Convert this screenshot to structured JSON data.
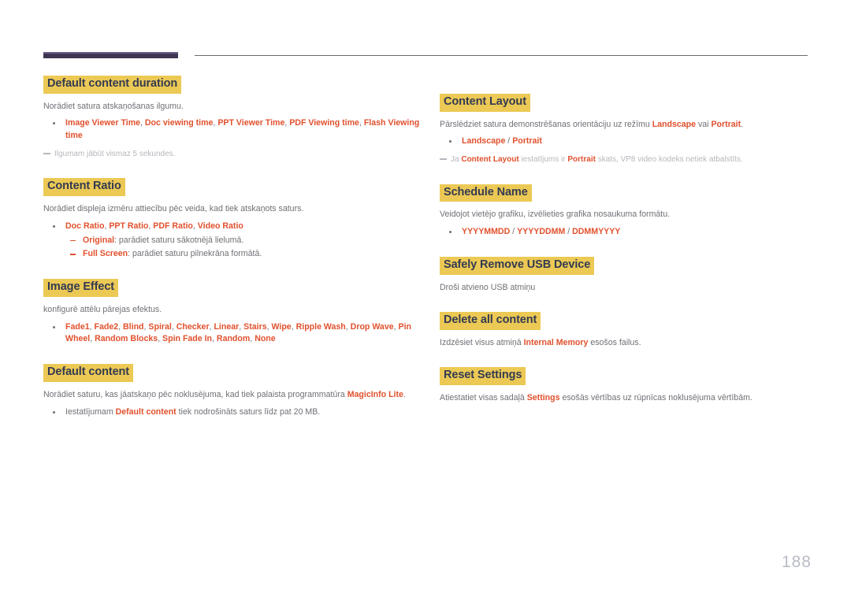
{
  "document": {
    "page_number": "188",
    "accent_highlight": "#ecc954",
    "accent_heading_text": "#333a52",
    "accent_keyword": "#e0512e",
    "body_text": "#6f7076",
    "header_bar": "#3e3552"
  },
  "left_column": [
    {
      "title": "Default content duration",
      "desc": "Norādiet satura atskaņošanas ilgumu.",
      "bullets": [
        {
          "parts": [
            {
              "t": "Image Viewer Time",
              "s": "key"
            },
            {
              "t": ", ",
              "s": "plain"
            },
            {
              "t": "Doc viewing time",
              "s": "key"
            },
            {
              "t": ", ",
              "s": "plain"
            },
            {
              "t": "PPT Viewer Time",
              "s": "key"
            },
            {
              "t": ", ",
              "s": "plain"
            },
            {
              "t": "PDF Viewing time",
              "s": "key"
            },
            {
              "t": ", ",
              "s": "plain"
            },
            {
              "t": "Flash Viewing time",
              "s": "key"
            }
          ]
        }
      ],
      "note": [
        {
          "t": "Ilgumam jābūt vismaz 5 sekundes.",
          "s": "plain"
        }
      ]
    },
    {
      "title": "Content Ratio",
      "desc": "Norādiet displeja izmēru attiecību pēc veida, kad tiek atskaņots saturs.",
      "bullets": [
        {
          "parts": [
            {
              "t": "Doc Ratio",
              "s": "key"
            },
            {
              "t": ", ",
              "s": "plain"
            },
            {
              "t": "PPT Ratio",
              "s": "key"
            },
            {
              "t": ", ",
              "s": "plain"
            },
            {
              "t": "PDF Ratio",
              "s": "key"
            },
            {
              "t": ", ",
              "s": "plain"
            },
            {
              "t": "Video Ratio",
              "s": "key"
            }
          ],
          "subbullets": [
            {
              "parts": [
                {
                  "t": "Original",
                  "s": "key"
                },
                {
                  "t": ": parādiet saturu sākotnējā lielumā.",
                  "s": "plain"
                }
              ]
            },
            {
              "parts": [
                {
                  "t": "Full Screen",
                  "s": "key"
                },
                {
                  "t": ": parādiet saturu pilnekrāna formātā.",
                  "s": "plain"
                }
              ]
            }
          ]
        }
      ]
    },
    {
      "title": "Image Effect",
      "desc": "konfigurē attēlu pārejas efektus.",
      "bullets": [
        {
          "parts": [
            {
              "t": "Fade1",
              "s": "key"
            },
            {
              "t": ", ",
              "s": "plain"
            },
            {
              "t": "Fade2",
              "s": "key"
            },
            {
              "t": ", ",
              "s": "plain"
            },
            {
              "t": "Blind",
              "s": "key"
            },
            {
              "t": ", ",
              "s": "plain"
            },
            {
              "t": "Spiral",
              "s": "key"
            },
            {
              "t": ", ",
              "s": "plain"
            },
            {
              "t": "Checker",
              "s": "key"
            },
            {
              "t": ", ",
              "s": "plain"
            },
            {
              "t": "Linear",
              "s": "key"
            },
            {
              "t": ", ",
              "s": "plain"
            },
            {
              "t": "Stairs",
              "s": "key"
            },
            {
              "t": ", ",
              "s": "plain"
            },
            {
              "t": "Wipe",
              "s": "key"
            },
            {
              "t": ", ",
              "s": "plain"
            },
            {
              "t": "Ripple Wash",
              "s": "key"
            },
            {
              "t": ", ",
              "s": "plain"
            },
            {
              "t": "Drop Wave",
              "s": "key"
            },
            {
              "t": ", ",
              "s": "plain"
            },
            {
              "t": "Pin Wheel",
              "s": "key"
            },
            {
              "t": ", ",
              "s": "plain"
            },
            {
              "t": "Random Blocks",
              "s": "key"
            },
            {
              "t": ", ",
              "s": "plain"
            },
            {
              "t": "Spin Fade In",
              "s": "key"
            },
            {
              "t": ", ",
              "s": "plain"
            },
            {
              "t": "Random",
              "s": "key"
            },
            {
              "t": ", ",
              "s": "plain"
            },
            {
              "t": "None",
              "s": "key"
            }
          ]
        }
      ]
    },
    {
      "title": "Default content",
      "desc_parts": [
        {
          "t": "Norādiet saturu, kas jāatskaņo pēc noklusējuma, kad tiek palaista programmatūra ",
          "s": "plain"
        },
        {
          "t": "MagicInfo Lite",
          "s": "key"
        },
        {
          "t": ".",
          "s": "plain"
        }
      ],
      "bullets": [
        {
          "parts": [
            {
              "t": "Iestatījumam ",
              "s": "plain"
            },
            {
              "t": "Default content",
              "s": "key"
            },
            {
              "t": " tiek nodrošināts saturs līdz pat 20 MB.",
              "s": "plain"
            }
          ]
        }
      ]
    }
  ],
  "right_column": [
    {
      "title": "Content Layout",
      "desc_parts": [
        {
          "t": "Pārslēdziet satura demonstrēšanas orientāciju uz režīmu ",
          "s": "plain"
        },
        {
          "t": "Landscape",
          "s": "key"
        },
        {
          "t": " vai ",
          "s": "plain"
        },
        {
          "t": "Portrait",
          "s": "key"
        },
        {
          "t": ".",
          "s": "plain"
        }
      ],
      "bullets": [
        {
          "parts": [
            {
              "t": "Landscape",
              "s": "key"
            },
            {
              "t": " / ",
              "s": "plain"
            },
            {
              "t": "Portrait",
              "s": "key"
            }
          ]
        }
      ],
      "note": [
        {
          "t": "Ja ",
          "s": "plain"
        },
        {
          "t": "Content Layout",
          "s": "key"
        },
        {
          "t": " iestatījums ir ",
          "s": "plain"
        },
        {
          "t": "Portrait",
          "s": "key"
        },
        {
          "t": " skats, VP8 video kodeks netiek atbalstīts.",
          "s": "plain"
        }
      ]
    },
    {
      "title": "Schedule Name",
      "desc": "Veidojot vietējo grafiku, izvēlieties grafika nosaukuma formātu.",
      "bullets": [
        {
          "parts": [
            {
              "t": "YYYYMMDD",
              "s": "key"
            },
            {
              "t": " / ",
              "s": "plain"
            },
            {
              "t": "YYYYDDMM",
              "s": "key"
            },
            {
              "t": " / ",
              "s": "plain"
            },
            {
              "t": "DDMMYYYY",
              "s": "key"
            }
          ]
        }
      ]
    },
    {
      "title": "Safely Remove USB Device",
      "desc": "Droši atvieno USB atmiņu",
      "bullets": []
    },
    {
      "title": "Delete all content",
      "desc_parts": [
        {
          "t": "Izdzēsiet visus atmiņā ",
          "s": "plain"
        },
        {
          "t": "Internal Memory",
          "s": "key"
        },
        {
          "t": " esošos failus.",
          "s": "plain"
        }
      ],
      "bullets": []
    },
    {
      "title": "Reset Settings",
      "desc_parts": [
        {
          "t": "Atiestatiet visas sadaļā ",
          "s": "plain"
        },
        {
          "t": "Settings",
          "s": "key"
        },
        {
          "t": " esošās vērtības uz rūpnīcas noklusējuma vērtībām.",
          "s": "plain"
        }
      ],
      "bullets": []
    }
  ]
}
